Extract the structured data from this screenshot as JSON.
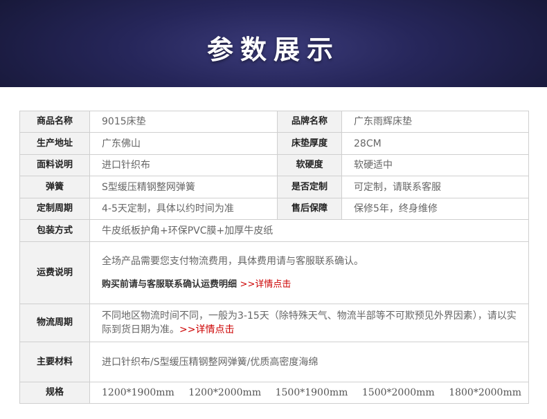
{
  "banner": {
    "title": "参数展示"
  },
  "rows": {
    "name_label": "商品名称",
    "name_value": "9015床垫",
    "brand_label": "品牌名称",
    "brand_value": "广东雨辉床垫",
    "origin_label": "生产地址",
    "origin_value": "广东佛山",
    "thickness_label": "床垫厚度",
    "thickness_value": "28CM",
    "fabric_label": "面料说明",
    "fabric_value": "进口针织布",
    "hardness_label": "软硬度",
    "hardness_value": "软硬适中",
    "spring_label": "弹簧",
    "spring_value": "S型缓压精钢整网弹簧",
    "custom_label": "是否定制",
    "custom_value": "可定制，请联系客服",
    "custom_cycle_label": "定制周期",
    "custom_cycle_value": "4-5天定制，具体以约时间为准",
    "aftersale_label": "售后保障",
    "aftersale_value": "保修5年，终身维修",
    "package_label": "包装方式",
    "package_value": "牛皮纸板护角+环保PVC膜+加厚牛皮纸",
    "shipping_label": "运费说明",
    "shipping_line1": "全场产品需要您支付物流费用，具体费用请与客服联系确认。",
    "shipping_line2": "购买前请与客服联系确认运费明细",
    "shipping_link": ">>详情点击",
    "logistics_label": "物流周期",
    "logistics_text": "不同地区物流时间不同，一般为3-15天（除特殊天气、物流半部等不可欺预见外界因素），请以实际到货日期为准。",
    "logistics_link": ">>详情点击",
    "material_label": "主要材料",
    "material_value": "进口针织布/S型缓压精钢整网弹簧/优质高密度海绵",
    "spec_label": "规格",
    "specs": [
      "1200*1900mm",
      "1200*2000mm",
      "1500*1900mm",
      "1500*2000mm",
      "1800*2000mm"
    ]
  },
  "colors": {
    "banner_bg": "#26265a",
    "label_bg": "#f2f2f2",
    "border": "#cfcfcf",
    "link": "#cc0000"
  }
}
